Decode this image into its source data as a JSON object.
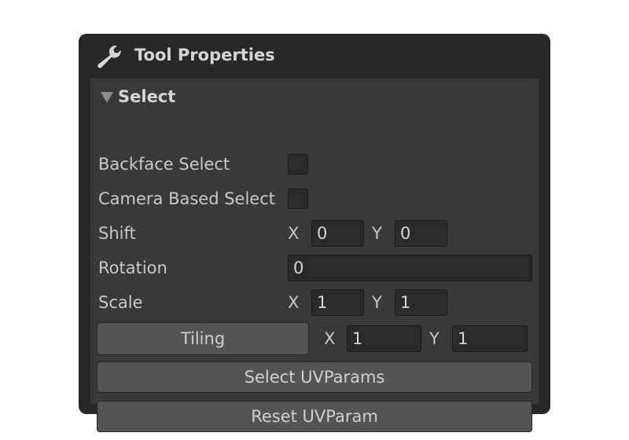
{
  "panel": {
    "title": "Tool Properties",
    "header_icon": "wrench-icon"
  },
  "section": {
    "title": "Select",
    "expanded": true,
    "collapse_icon": "triangle-down-icon"
  },
  "rows": {
    "backface_select": {
      "label": "Backface Select",
      "checked": false
    },
    "camera_based_select": {
      "label": "Camera Based Select",
      "checked": false
    },
    "shift": {
      "label": "Shift",
      "x_label": "X",
      "x_value": "0",
      "y_label": "Y",
      "y_value": "0"
    },
    "rotation": {
      "label": "Rotation",
      "value": "0"
    },
    "scale": {
      "label": "Scale",
      "x_label": "X",
      "x_value": "1",
      "y_label": "Y",
      "y_value": "1"
    },
    "tiling": {
      "button_label": "Tiling",
      "x_label": "X",
      "x_value": "1",
      "y_label": "Y",
      "y_value": "1"
    }
  },
  "buttons": {
    "select_uvparams": "Select UVParams",
    "reset_uvparam": "Reset UVParam"
  },
  "colors": {
    "panel_bg": "#282828",
    "body_bg": "#393939",
    "field_bg": "#2a2a2a",
    "button_bg": "#545454",
    "text": "#c9c9c9"
  }
}
